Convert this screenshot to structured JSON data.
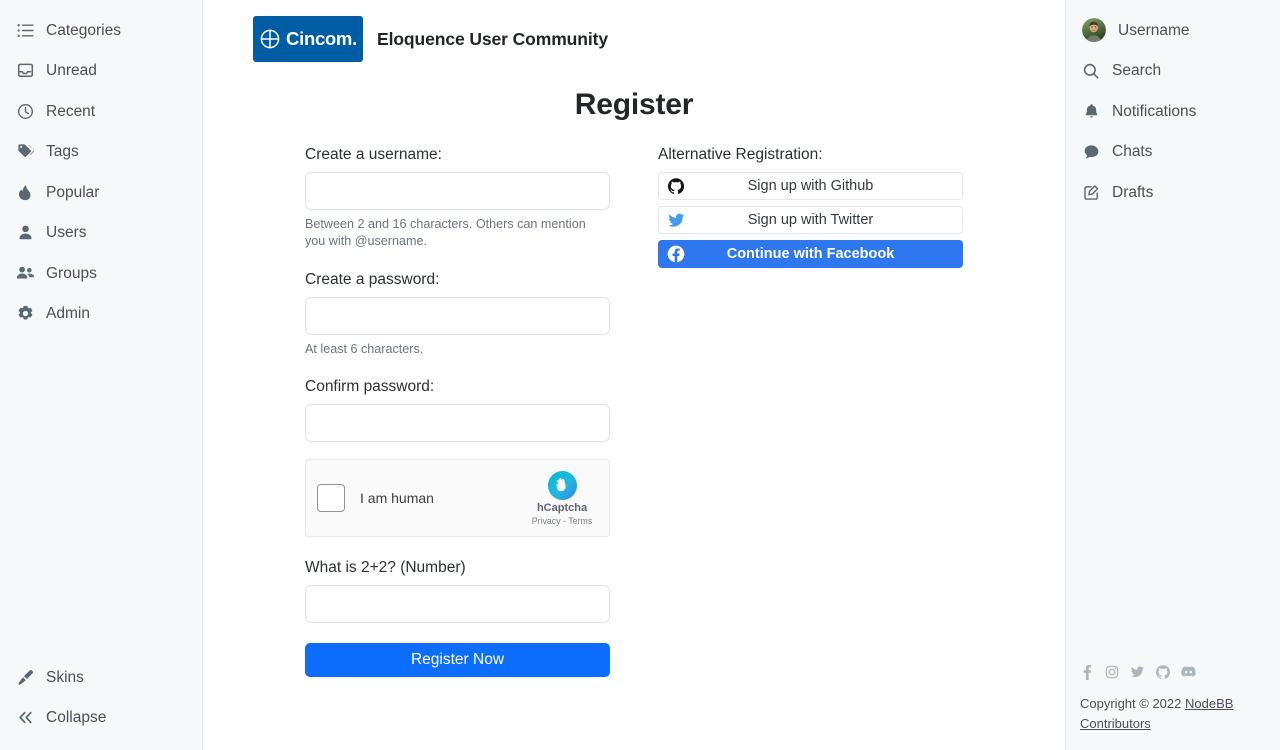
{
  "left_sidebar": {
    "items": [
      {
        "label": "Categories",
        "icon": "list-icon"
      },
      {
        "label": "Unread",
        "icon": "inbox-icon"
      },
      {
        "label": "Recent",
        "icon": "clock-icon"
      },
      {
        "label": "Tags",
        "icon": "tags-icon"
      },
      {
        "label": "Popular",
        "icon": "fire-icon"
      },
      {
        "label": "Users",
        "icon": "user-icon"
      },
      {
        "label": "Groups",
        "icon": "users-icon"
      },
      {
        "label": "Admin",
        "icon": "gear-icon"
      }
    ],
    "bottom_items": [
      {
        "label": "Skins",
        "icon": "paintbrush-icon"
      },
      {
        "label": "Collapse",
        "icon": "chevron-double-left-icon"
      }
    ]
  },
  "header": {
    "logo_text": "Cincom.",
    "logo_bg": "#005da4",
    "site_title": "Eloquence User Community"
  },
  "main": {
    "page_title": "Register",
    "fields": {
      "username": {
        "label": "Create a username:",
        "value": "",
        "placeholder": "",
        "help": "Between 2 and 16 characters. Others can mention you with @username."
      },
      "password": {
        "label": "Create a password:",
        "value": "",
        "placeholder": "",
        "help": "At least 6 characters."
      },
      "confirm_password": {
        "label": "Confirm password:",
        "value": "",
        "placeholder": ""
      },
      "question": {
        "label": "What is 2+2? (Number)",
        "value": "",
        "placeholder": ""
      }
    },
    "captcha": {
      "checkbox_label": "I am human",
      "brand": "hCaptcha",
      "privacy": "Privacy",
      "separator": "-",
      "terms": "Terms"
    },
    "submit_label": "Register Now",
    "alternative": {
      "label": "Alternative Registration:",
      "buttons": [
        {
          "label": "Sign up with Github",
          "icon": "github-icon",
          "style": "light"
        },
        {
          "label": "Sign up with Twitter",
          "icon": "twitter-icon",
          "style": "light"
        },
        {
          "label": "Continue with Facebook",
          "icon": "facebook-icon",
          "style": "facebook",
          "color": "#2f77ee"
        }
      ]
    }
  },
  "right_sidebar": {
    "items": [
      {
        "label": "Username",
        "icon": "avatar"
      },
      {
        "label": "Search",
        "icon": "search-icon"
      },
      {
        "label": "Notifications",
        "icon": "bell-icon"
      },
      {
        "label": "Chats",
        "icon": "chat-icon"
      },
      {
        "label": "Drafts",
        "icon": "draft-pencil-icon"
      }
    ],
    "footer": {
      "social": [
        "facebook-icon",
        "instagram-icon",
        "twitter-icon",
        "github-icon",
        "discord-icon"
      ],
      "copyright_prefix": "Copyright © 2022 ",
      "copyright_link": "NodeBB Contributors"
    }
  },
  "colors": {
    "sidebar_bg": "#f7f8f9",
    "primary": "#0d6efd",
    "facebook": "#2f77ee",
    "brand_blue": "#005da4",
    "text": "#212529",
    "muted": "#6c757d"
  }
}
